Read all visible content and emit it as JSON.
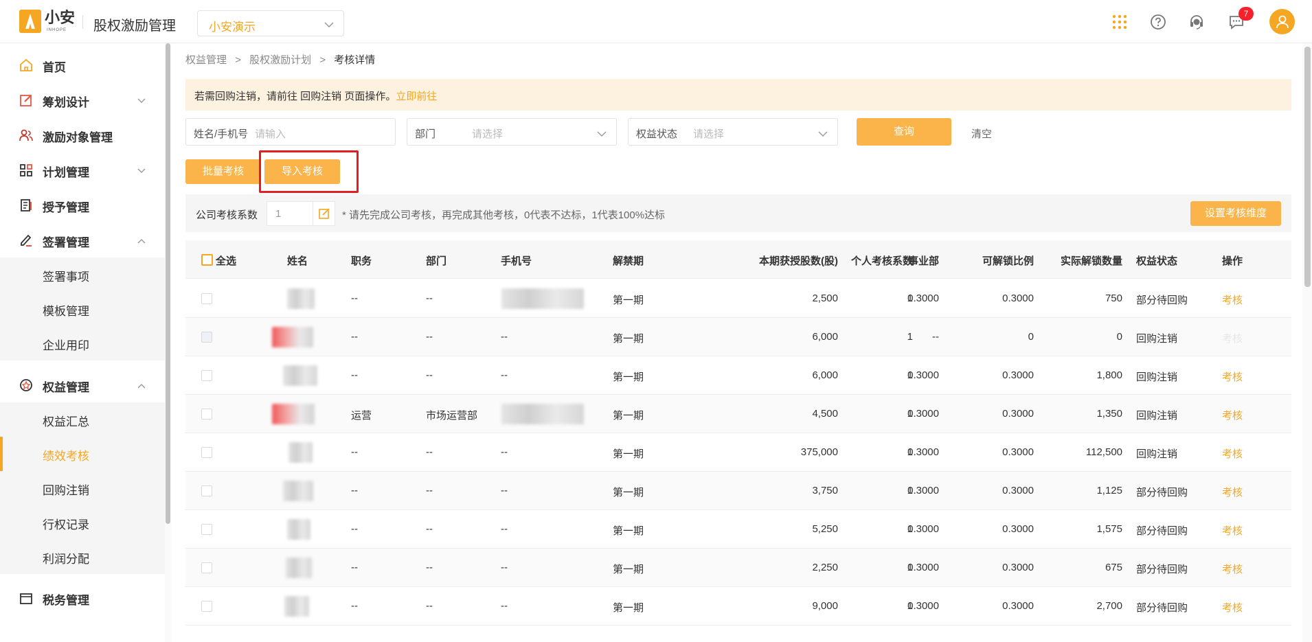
{
  "header": {
    "logo_text": "小安",
    "logo_sub": "INHOPE",
    "app_title": "股权激励管理",
    "company": "小安演示",
    "notification_count": "7"
  },
  "sidebar": {
    "items": [
      {
        "label": "首页"
      },
      {
        "label": "筹划设计"
      },
      {
        "label": "激励对象管理"
      },
      {
        "label": "计划管理"
      },
      {
        "label": "授予管理"
      },
      {
        "label": "签署管理"
      },
      {
        "label": "签署事项"
      },
      {
        "label": "模板管理"
      },
      {
        "label": "企业用印"
      },
      {
        "label": "权益管理"
      },
      {
        "label": "权益汇总"
      },
      {
        "label": "绩效考核"
      },
      {
        "label": "回购注销"
      },
      {
        "label": "行权记录"
      },
      {
        "label": "利润分配"
      },
      {
        "label": "税务管理"
      }
    ]
  },
  "breadcrumb": [
    "权益管理",
    "股权激励计划",
    "考核详情"
  ],
  "notice": {
    "text": "若需回购注销，请前往 回购注销 页面操作。",
    "link": "立即前往"
  },
  "filters": {
    "name_label": "姓名/手机号",
    "name_placeholder": "请输入",
    "dept_label": "部门",
    "dept_placeholder": "请选择",
    "status_label": "权益状态",
    "status_placeholder": "请选择",
    "query": "查询",
    "clear": "清空"
  },
  "actions": {
    "batch": "批量考核",
    "import": "导入考核"
  },
  "coef": {
    "label": "公司考核系数",
    "value": "1",
    "hint": "* 请先完成公司考核，再完成其他考核，0代表不达标，1代表100%达标",
    "set_button": "设置考核维度"
  },
  "table": {
    "headers": {
      "select_all": "全选",
      "name": "姓名",
      "position": "职务",
      "dept": "部门",
      "phone": "手机号",
      "period": "解禁期",
      "shares": "本期获授股数(股)",
      "personal": "个人考核系数",
      "division": "事业部",
      "ratio": "可解锁比例",
      "actual": "实际解锁数量",
      "status": "权益状态",
      "op": "操作"
    },
    "rows": [
      {
        "position": "--",
        "dept": "--",
        "phone": "",
        "period": "第一期",
        "shares": "2,500",
        "personal": "1",
        "division": "0.3000",
        "ratio": "0.3000",
        "actual": "750",
        "status": "部分待回购",
        "op": "考核"
      },
      {
        "position": "--",
        "dept": "--",
        "phone": "--",
        "period": "第一期",
        "shares": "6,000",
        "personal": "1",
        "division": "--",
        "ratio": "0",
        "actual": "0",
        "status": "回购注销",
        "op": "考核"
      },
      {
        "position": "--",
        "dept": "--",
        "phone": "--",
        "period": "第一期",
        "shares": "6,000",
        "personal": "1",
        "division": "0.3000",
        "ratio": "0.3000",
        "actual": "1,800",
        "status": "回购注销",
        "op": "考核"
      },
      {
        "position": "运营",
        "dept": "市场运营部",
        "phone": "",
        "period": "第一期",
        "shares": "4,500",
        "personal": "1",
        "division": "0.3000",
        "ratio": "0.3000",
        "actual": "1,350",
        "status": "回购注销",
        "op": "考核"
      },
      {
        "position": "--",
        "dept": "--",
        "phone": "--",
        "period": "第一期",
        "shares": "375,000",
        "personal": "1",
        "division": "0.3000",
        "ratio": "0.3000",
        "actual": "112,500",
        "status": "回购注销",
        "op": "考核"
      },
      {
        "position": "--",
        "dept": "--",
        "phone": "--",
        "period": "第一期",
        "shares": "3,750",
        "personal": "1",
        "division": "0.3000",
        "ratio": "0.3000",
        "actual": "1,125",
        "status": "部分待回购",
        "op": "考核"
      },
      {
        "position": "--",
        "dept": "--",
        "phone": "--",
        "period": "第一期",
        "shares": "5,250",
        "personal": "1",
        "division": "0.3000",
        "ratio": "0.3000",
        "actual": "1,575",
        "status": "部分待回购",
        "op": "考核"
      },
      {
        "position": "--",
        "dept": "--",
        "phone": "--",
        "period": "第一期",
        "shares": "2,250",
        "personal": "1",
        "division": "0.3000",
        "ratio": "0.3000",
        "actual": "675",
        "status": "部分待回购",
        "op": "考核"
      },
      {
        "position": "--",
        "dept": "--",
        "phone": "--",
        "period": "第一期",
        "shares": "9,000",
        "personal": "1",
        "division": "0.3000",
        "ratio": "0.3000",
        "actual": "2,700",
        "status": "部分待回购",
        "op": "考核"
      }
    ]
  },
  "colors": {
    "accent": "#f5a623",
    "button": "#fbb449",
    "notice_bg": "#fdf1e0",
    "badge": "#f5222d"
  }
}
